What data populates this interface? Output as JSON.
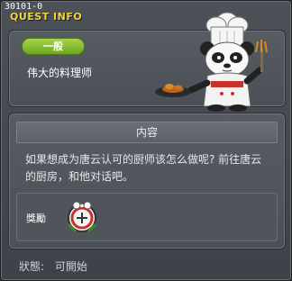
{
  "quest_window": {
    "quest_id": "30101-0",
    "title": "QUEST INFO"
  },
  "summary": {
    "category": "一般",
    "quest_name": "伟大的料理师",
    "npc_icon": "panda-chef-icon"
  },
  "content": {
    "header": "内容",
    "description": "如果想成为唐云认可的厨师该怎么做呢? 前往唐云的厨房，和他对话吧。"
  },
  "reward": {
    "label": "獎勵",
    "icon": "chef-badge-icon"
  },
  "status": {
    "label": "狀態:",
    "value": "可開始"
  },
  "colors": {
    "title": "#f4d33a",
    "category_badge": "#8cc230",
    "window_bg": "#464b52"
  }
}
